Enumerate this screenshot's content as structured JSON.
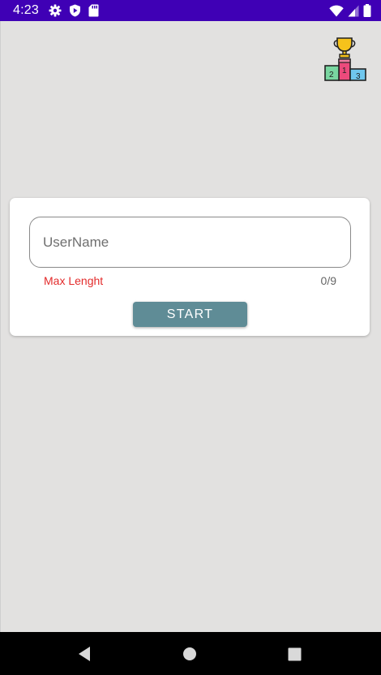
{
  "status_bar": {
    "time": "4:23",
    "left_icons": [
      "gear-icon",
      "shield-play-icon",
      "sd-card-icon"
    ],
    "right_icons": [
      "wifi-icon",
      "cell-signal-icon",
      "battery-icon"
    ],
    "background": "#3f00b5"
  },
  "header": {
    "leaderboard_icon": "podium-trophy-icon",
    "podium_labels": [
      "2",
      "1",
      "3"
    ]
  },
  "form": {
    "username_placeholder": "UserName",
    "username_value": "",
    "helper_text": "Max Lenght",
    "counter": "0/9",
    "start_label": "START"
  },
  "colors": {
    "background": "#e2e1e0",
    "button": "#5f8c96",
    "helper": "#e32b2b"
  },
  "nav_bar": {
    "icons": [
      "back-icon",
      "home-icon",
      "recents-icon"
    ]
  }
}
